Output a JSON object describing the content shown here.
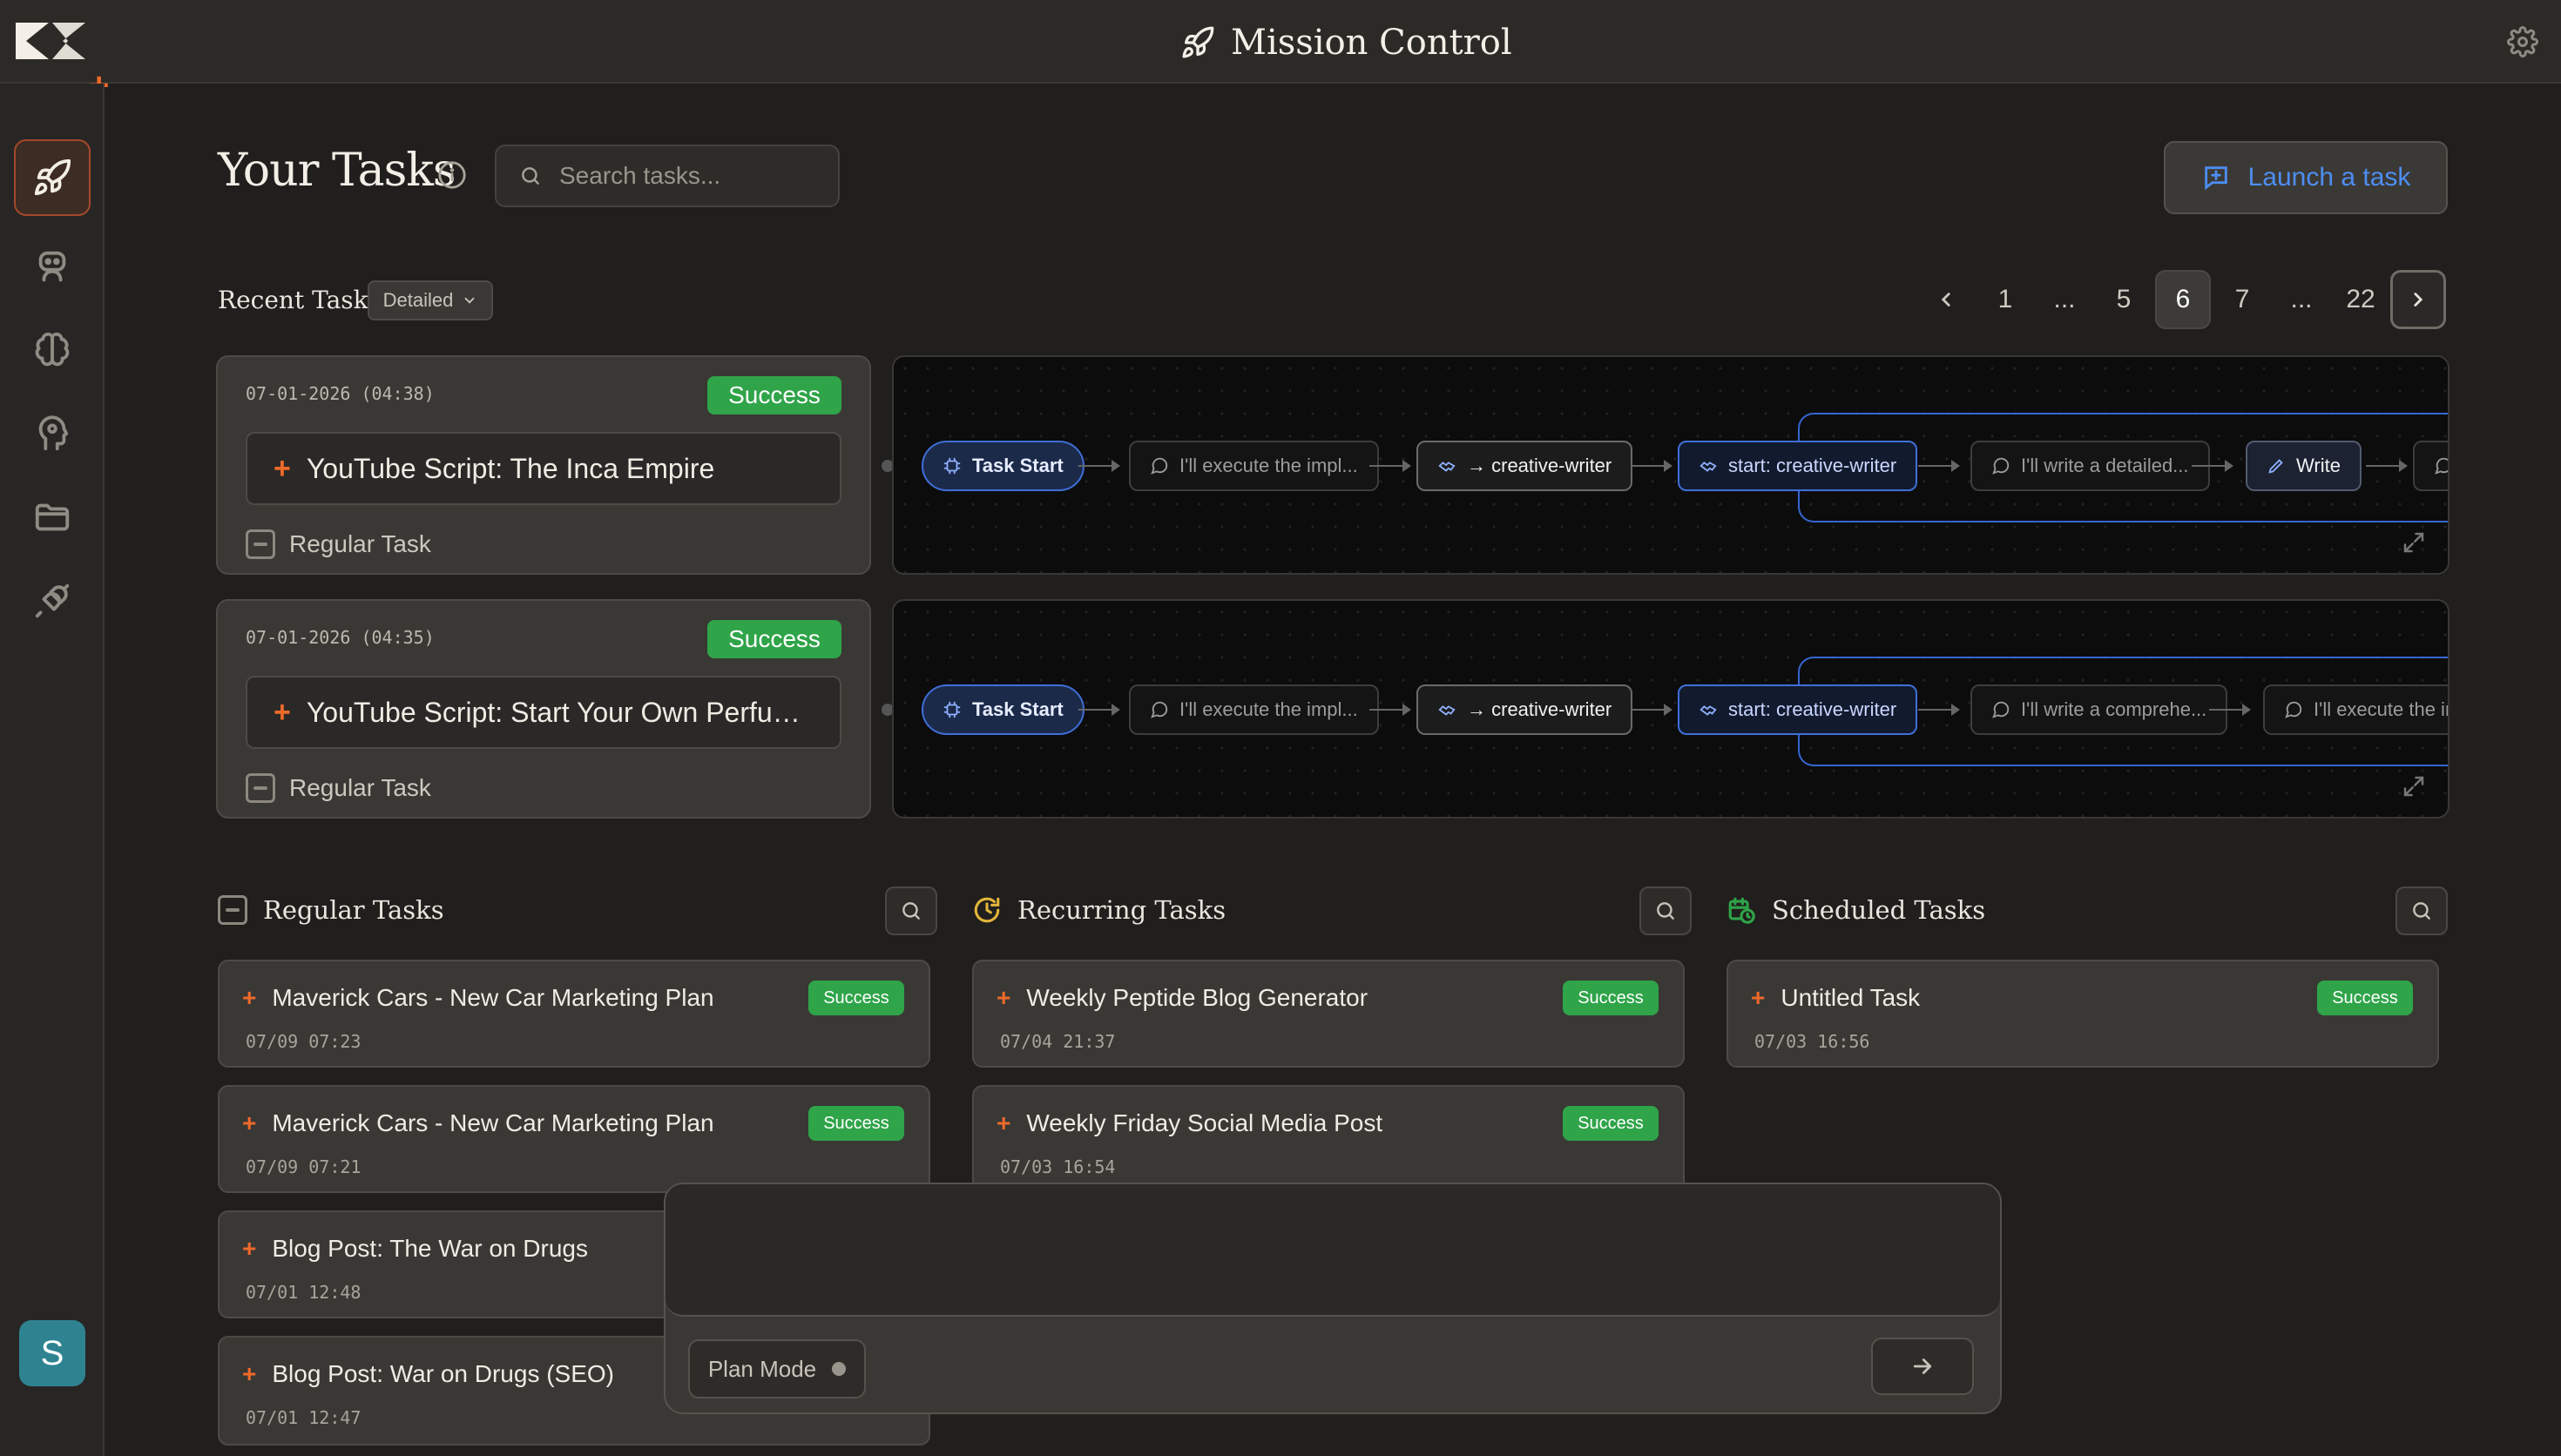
{
  "app": {
    "title": "Mission Control"
  },
  "header": {
    "title": "Your Tasks",
    "search_placeholder": "Search tasks...",
    "launch_label": "Launch a task"
  },
  "user": {
    "initial": "S"
  },
  "recent": {
    "label": "Recent Tasks",
    "view_mode": "Detailed",
    "pagination": [
      "1",
      "...",
      "5",
      "6",
      "7",
      "...",
      "22"
    ],
    "current_page": "6",
    "cards": [
      {
        "date": "07-01-2026 (04:38)",
        "status": "Success",
        "name": "YouTube Script: The Inca Empire",
        "type": "Regular Task",
        "flow": {
          "start": "Task Start",
          "msg1": "I'll execute the impl...",
          "agent": "→ creative-writer",
          "agent_start": "start: creative-writer",
          "msg2": "I'll write a detailed...",
          "tool": "Write"
        }
      },
      {
        "date": "07-01-2026 (04:35)",
        "status": "Success",
        "name": "YouTube Script: Start Your Own Perfume Brand",
        "type": "Regular Task",
        "flow": {
          "start": "Task Start",
          "msg1": "I'll execute the impl...",
          "agent": "→ creative-writer",
          "agent_start": "start: creative-writer",
          "msg2": "I'll write a comprehe...",
          "msg3": "I'll execute the im"
        }
      }
    ]
  },
  "columns": {
    "regular": {
      "title": "Regular Tasks",
      "items": [
        {
          "name": "Maverick Cars - New Car Marketing Plan",
          "time": "07/09 07:23",
          "status": "Success"
        },
        {
          "name": "Maverick Cars - New Car Marketing Plan",
          "time": "07/09 07:21",
          "status": "Success"
        },
        {
          "name": "Blog Post: The War on Drugs",
          "time": "07/01 12:48",
          "status": ""
        },
        {
          "name": "Blog Post: War on Drugs (SEO)",
          "time": "07/01 12:47",
          "status": ""
        }
      ]
    },
    "recurring": {
      "title": "Recurring Tasks",
      "items": [
        {
          "name": "Weekly Peptide Blog Generator",
          "time": "07/04 21:37",
          "status": "Success"
        },
        {
          "name": "Weekly Friday Social Media Post",
          "time": "07/03 16:54",
          "status": "Success"
        }
      ]
    },
    "scheduled": {
      "title": "Scheduled Tasks",
      "items": [
        {
          "name": "Untitled Task",
          "time": "07/03 16:56",
          "status": "Success"
        }
      ]
    }
  },
  "composer": {
    "placeholder": "",
    "plan_mode_label": "Plan Mode"
  },
  "colors": {
    "accent_orange": "#ec6a2a",
    "accent_blue": "#4d8ef2",
    "success_green": "#2fa449",
    "recurring_icon": "#e2b53a",
    "scheduled_icon": "#2fa449"
  },
  "icons": [
    "logo",
    "rocket-icon",
    "gear-icon",
    "robot-icon",
    "brain-icon",
    "head-icon",
    "folder-icon",
    "plug-icon",
    "info-icon",
    "search-icon",
    "plus-square-icon",
    "chevron-down-icon",
    "chevron-left-icon",
    "chevron-right-icon",
    "expand-icon",
    "arrow-right-icon"
  ]
}
